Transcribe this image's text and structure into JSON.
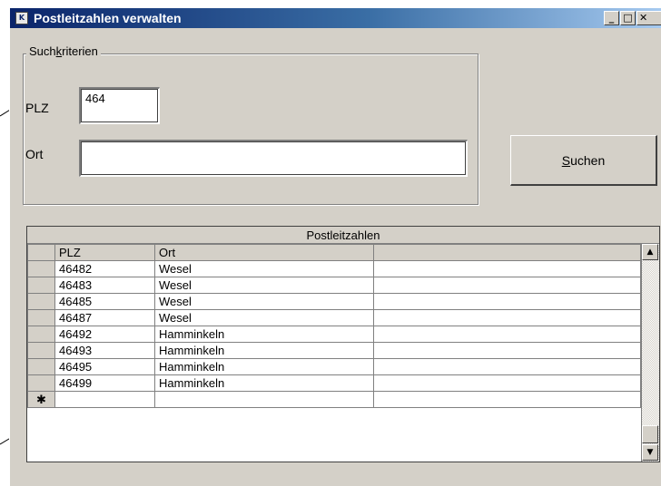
{
  "window": {
    "title": "Postleitzahlen verwalten",
    "icon": "app-icon",
    "controls": {
      "minimize": "_",
      "maximize": "□",
      "close": "✕"
    }
  },
  "search": {
    "group_label_pre": "Such",
    "group_label_accel": "k",
    "group_label_post": "riterien",
    "plz_label": "PLZ",
    "plz_value": "464",
    "ort_label": "Ort",
    "ort_value": "",
    "button_accel": "S",
    "button_rest": "uchen"
  },
  "grid": {
    "caption": "Postleitzahlen",
    "columns": [
      "PLZ",
      "Ort",
      ""
    ],
    "rows": [
      {
        "plz": "46482",
        "ort": "Wesel"
      },
      {
        "plz": "46483",
        "ort": "Wesel"
      },
      {
        "plz": "46485",
        "ort": "Wesel"
      },
      {
        "plz": "46487",
        "ort": "Wesel"
      },
      {
        "plz": "46492",
        "ort": "Hamminkeln"
      },
      {
        "plz": "46493",
        "ort": "Hamminkeln"
      },
      {
        "plz": "46495",
        "ort": "Hamminkeln"
      },
      {
        "plz": "46499",
        "ort": "Hamminkeln"
      }
    ],
    "new_row_marker": "✱"
  }
}
